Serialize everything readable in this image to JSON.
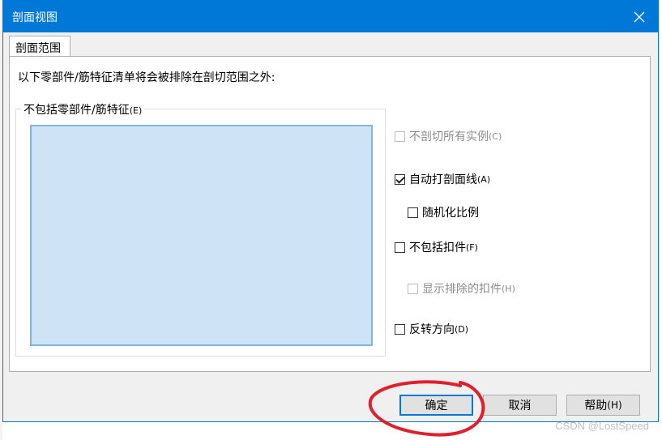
{
  "window": {
    "title": "剖面视图",
    "tab_label": "剖面范围"
  },
  "panel": {
    "description": "以下零部件/筋特征清单将会被排除在剖切范围之外:",
    "group_label": "不包括零部件/筋特征",
    "group_accel": "(E)",
    "list_items": []
  },
  "options": [
    {
      "label": "不剖切所有实例",
      "accel": "(C)",
      "checked": false,
      "enabled": false
    },
    {
      "label": "自动打剖面线",
      "accel": "(A)",
      "checked": true,
      "enabled": true
    },
    {
      "label": "随机化比例",
      "accel": "",
      "checked": false,
      "enabled": true
    },
    {
      "label": "不包括扣件",
      "accel": "(F)",
      "checked": false,
      "enabled": true
    },
    {
      "label": "显示排除的扣件",
      "accel": "(H)",
      "checked": false,
      "enabled": false
    },
    {
      "label": "反转方向",
      "accel": "(D)",
      "checked": false,
      "enabled": true
    }
  ],
  "buttons": {
    "ok": "确定",
    "cancel": "取消",
    "help": "帮助",
    "help_accel": "(H)"
  },
  "watermark": "CSDN @LostSpeed",
  "colors": {
    "titlebar": "#0078d7",
    "list_bg": "#cfe3f6",
    "annotation": "#e0202a"
  }
}
